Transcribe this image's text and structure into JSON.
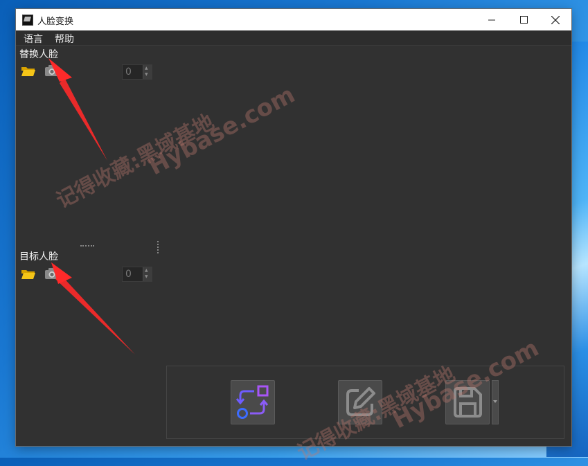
{
  "window": {
    "title": "人脸变换"
  },
  "menu": {
    "items": [
      "语言",
      "帮助"
    ]
  },
  "replace_section": {
    "label": "替换人脸",
    "spin_value": "0"
  },
  "target_section": {
    "label": "目标人脸",
    "spin_value": "0"
  },
  "watermark": {
    "cn": "记得收藏:黑域基地",
    "en": "Hybase.com"
  },
  "colors": {
    "accent_purple": "#9b59ff",
    "accent_blue": "#3d6cff",
    "arrow_red": "#ff2a2a",
    "folder_yellow": "#f5c518"
  },
  "actions": {
    "swap_icon": "swap-icon",
    "edit_icon": "edit-icon",
    "save_icon": "save-icon"
  }
}
